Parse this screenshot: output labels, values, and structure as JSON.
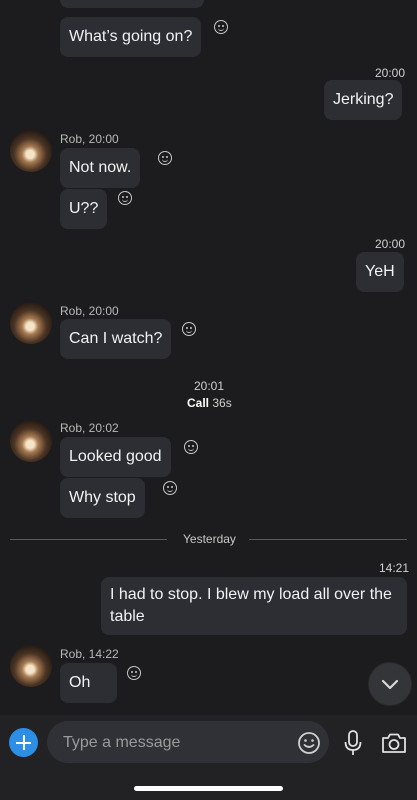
{
  "messages": {
    "prev_out": "What’s going on?",
    "t1": "20:00",
    "m1": "Jerking?",
    "rob1_sender": "Rob, 20:00",
    "rob1_a": "Not now.",
    "rob1_b": "U??",
    "t2": "20:00",
    "m2": "YeH",
    "rob2_sender": "Rob, 20:00",
    "rob2_a": "Can I watch?",
    "call_time": "20:01",
    "call_label": "Call",
    "call_duration": "36s",
    "rob3_sender": "Rob, 20:02",
    "rob3_a": "Looked good",
    "rob3_b": "Why stop",
    "divider_label": "Yesterday",
    "t3": "14:21",
    "m3": "I had to stop. I blew my load all over the table",
    "rob4_sender": "Rob, 14:22",
    "rob4_a": "Oh"
  },
  "composer": {
    "placeholder": "Type a message"
  },
  "colors": {
    "background": "#1c1c1e",
    "bubble": "#2c2e33",
    "accent": "#2d8ee6"
  },
  "icons": [
    "smiley-icon",
    "plus-icon",
    "chevron-down-icon",
    "microphone-icon",
    "camera-icon"
  ]
}
